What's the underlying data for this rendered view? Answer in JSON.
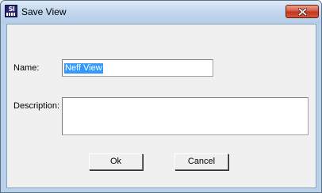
{
  "window": {
    "title": "Save View",
    "app_icon": "si-app-icon",
    "close_icon": "close-icon",
    "close_button_color": "#c9412a",
    "title_bar_color": "#c4d8ee"
  },
  "form": {
    "name_label": "Name:",
    "name_value": "Neff View",
    "description_label": "Description:",
    "description_value": ""
  },
  "buttons": {
    "ok_label": "Ok",
    "cancel_label": "Cancel"
  },
  "selection_color": "#3399ff"
}
